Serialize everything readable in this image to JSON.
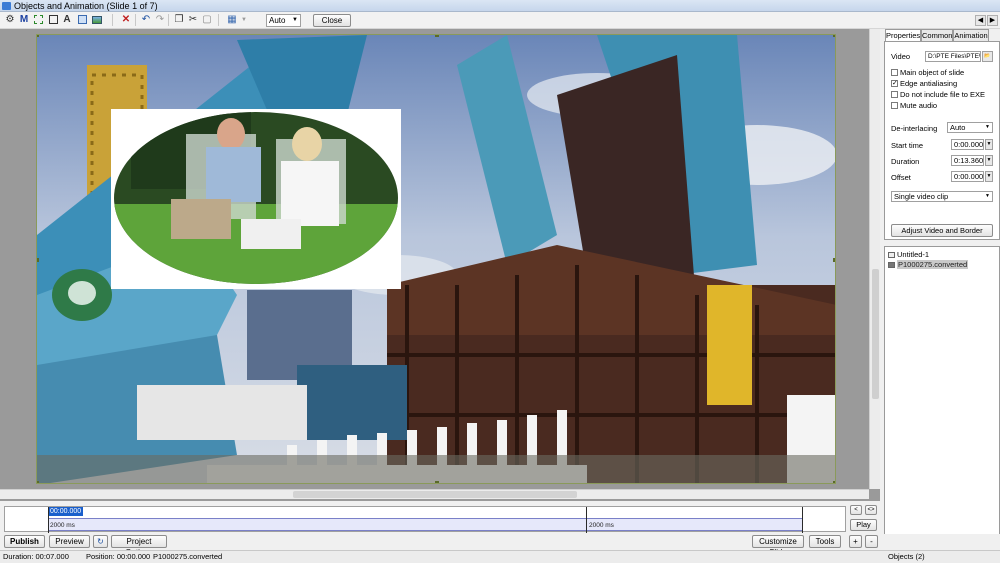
{
  "window": {
    "title": "Objects and Animation (Slide 1 of 7)"
  },
  "toolbar": {
    "zoom_value": "Auto",
    "close_label": "Close",
    "icons": [
      "select-tool",
      "text-m",
      "frame",
      "text-a",
      "rectangle",
      "image",
      "delete",
      "undo",
      "redo",
      "copy",
      "cut",
      "paste",
      "grid"
    ]
  },
  "panel": {
    "tabs": [
      "Properties",
      "Common",
      "Animation"
    ],
    "video_label": "Video",
    "video_path": "D:\\PTE Files\\PTE\\ver",
    "checkboxes": [
      {
        "label": "Main object of slide",
        "checked": false
      },
      {
        "label": "Edge antialiasing",
        "checked": true
      },
      {
        "label": "Do not include file to EXE",
        "checked": false
      },
      {
        "label": "Mute audio",
        "checked": false
      }
    ],
    "deinterlacing_label": "De-interlacing",
    "deinterlacing_value": "Auto",
    "start_time_label": "Start time",
    "start_time_value": "0:00.000",
    "duration_label": "Duration",
    "duration_value": "0:13.360",
    "offset_label": "Offset",
    "offset_value": "0:00.000",
    "clip_mode": "Single video clip",
    "adjust_button": "Adjust Video and Border"
  },
  "objects": {
    "items": [
      {
        "label": "Untitled-1",
        "selected": false
      },
      {
        "label": "P1000275.converted",
        "selected": true
      }
    ]
  },
  "timeline": {
    "current_time": "00:00.000",
    "segment1": "2000 ms",
    "segment2": "2000 ms",
    "play_label": "Play",
    "nav_prev": "<",
    "nav_next": "<>"
  },
  "bottom": {
    "publish": "Publish",
    "preview": "Preview",
    "project_options": "Project Options",
    "customize_slide": "Customize Slide",
    "tools": "Tools",
    "plus": "+",
    "minus": "-"
  },
  "status": {
    "duration": "Duration:  00:07.000",
    "position": "Position:  00:00.000",
    "file": "P1000275.converted",
    "objects": "Objects (2)"
  },
  "colors": {
    "selection": "#1a5fcc",
    "timeline_band": "#e6e8fa"
  }
}
